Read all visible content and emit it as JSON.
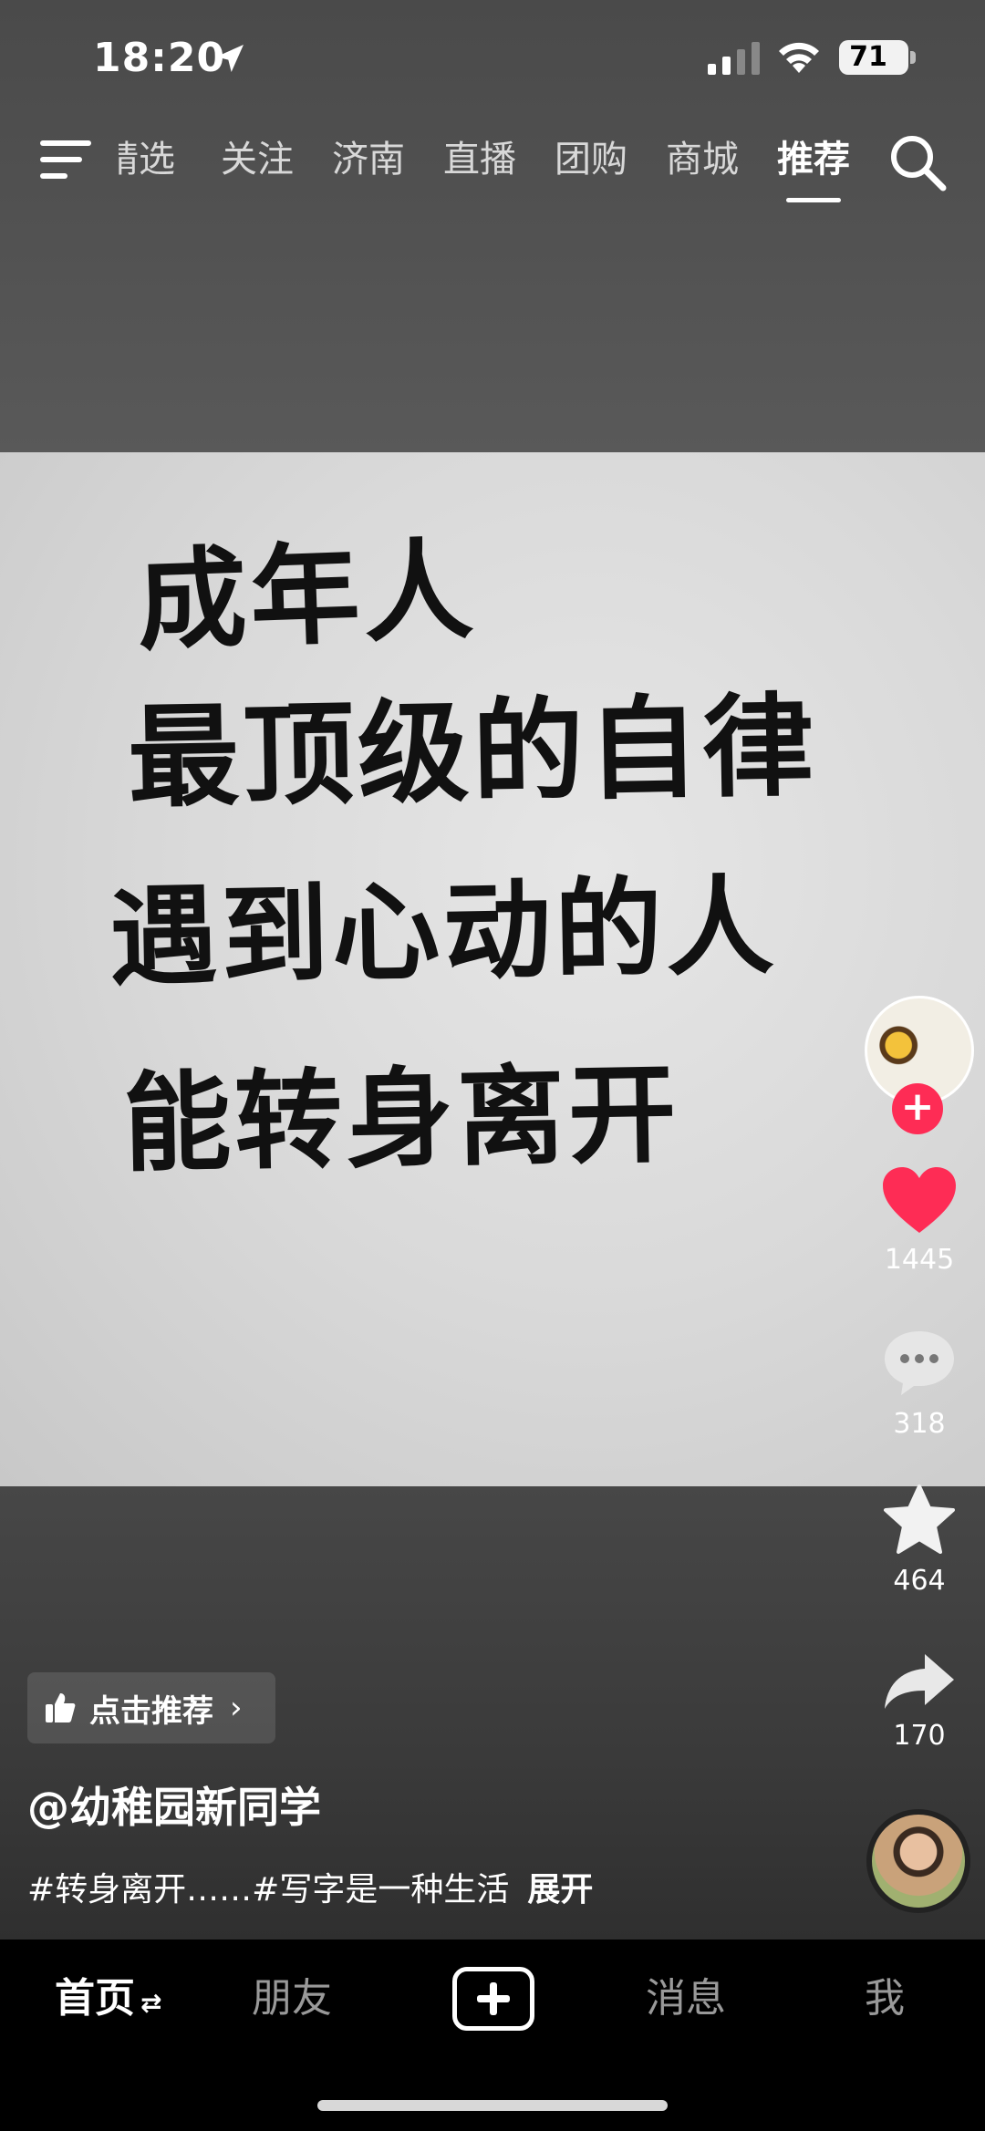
{
  "status_bar": {
    "time": "18:20",
    "battery": "71"
  },
  "top_nav": {
    "tabs": [
      {
        "label": "精选",
        "active": false
      },
      {
        "label": "关注",
        "active": false
      },
      {
        "label": "济南",
        "active": false
      },
      {
        "label": "直播",
        "active": false
      },
      {
        "label": "团购",
        "active": false
      },
      {
        "label": "商城",
        "active": false
      },
      {
        "label": "推荐",
        "active": true
      }
    ]
  },
  "video": {
    "lines": [
      "成年人",
      "最顶级的自律",
      "遇到心动的人",
      "能转身离开"
    ]
  },
  "rail": {
    "likes": "1445",
    "comments": "318",
    "favorites": "464",
    "shares": "170",
    "like_color": "#fe2c55"
  },
  "info": {
    "recommend_label": "点击推荐",
    "author": "@幼稚园新同学",
    "caption": "#转身离开……#写字是一种生活",
    "expand": "展开"
  },
  "tabbar": {
    "home": "首页",
    "friends": "朋友",
    "messages": "消息",
    "me": "我"
  }
}
